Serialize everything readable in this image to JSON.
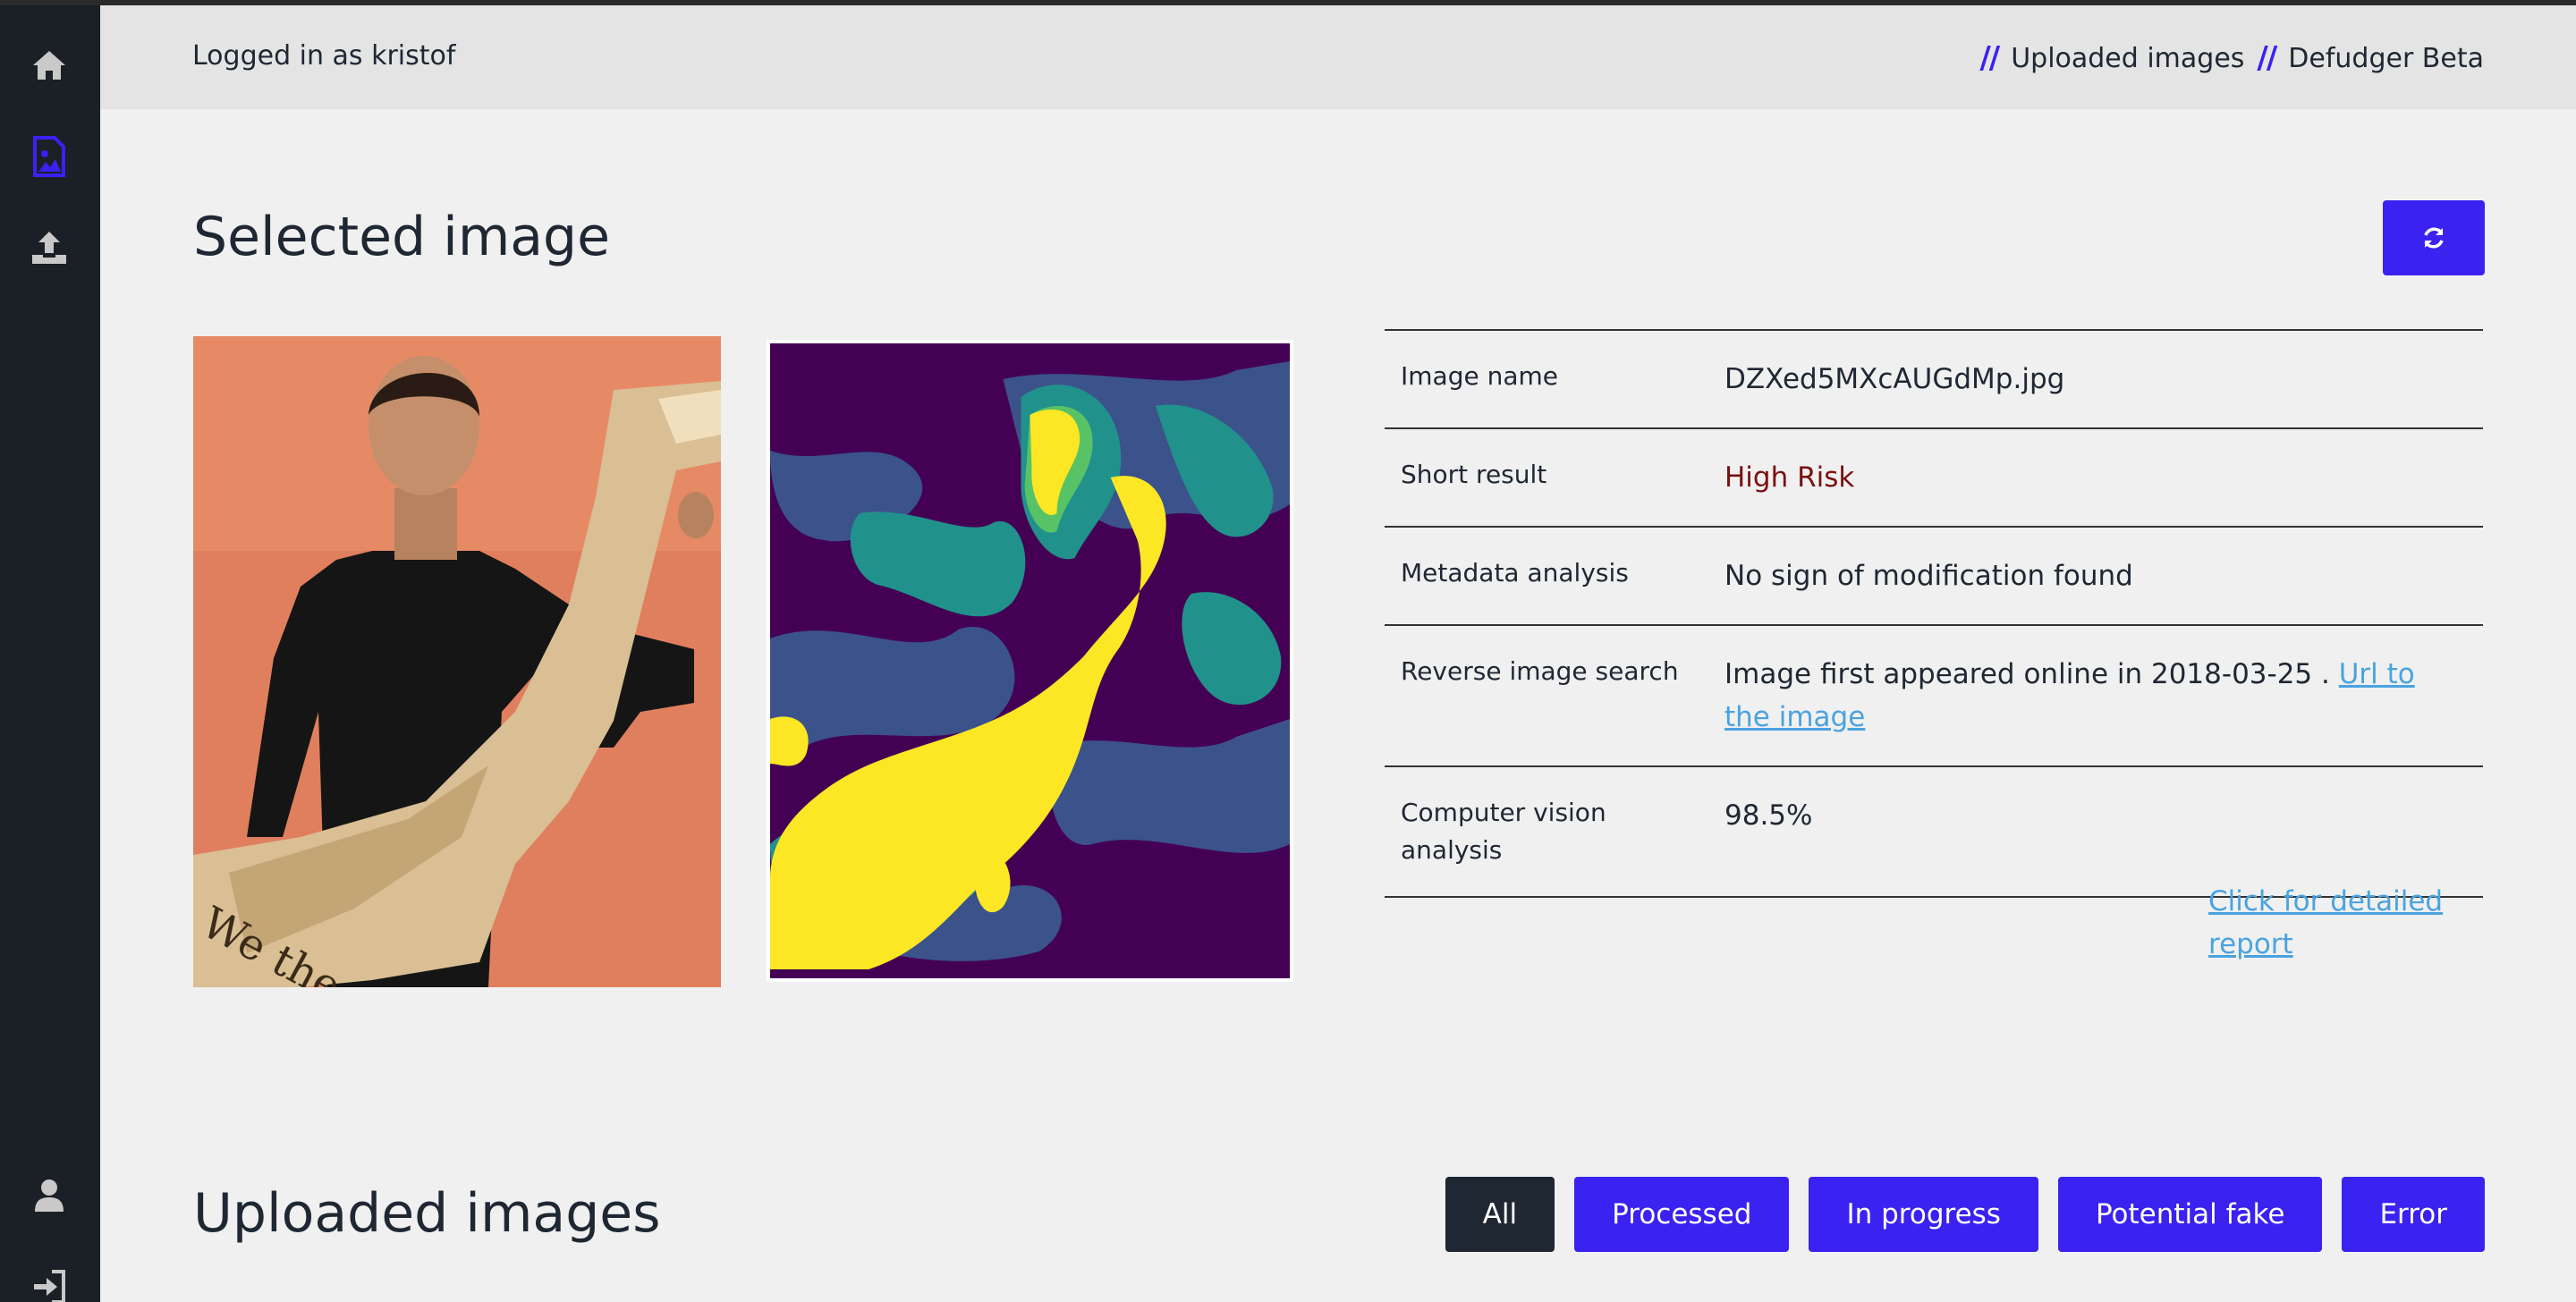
{
  "header": {
    "logged_in": "Logged in as kristof",
    "breadcrumbs": [
      {
        "sep": "//",
        "label": "Uploaded images"
      },
      {
        "sep": "//",
        "label": "Defudger Beta"
      }
    ]
  },
  "sidebar": {
    "items": [
      {
        "icon": "home-icon"
      },
      {
        "icon": "image-file-icon",
        "active": true
      },
      {
        "icon": "upload-icon"
      },
      {
        "icon": "user-icon"
      },
      {
        "icon": "sign-in-icon"
      }
    ]
  },
  "selected": {
    "title": "Selected image",
    "refresh_icon": "refresh-icon",
    "rows": [
      {
        "label": "Image name",
        "value": "DZXed5MXcAUGdMp.jpg"
      },
      {
        "label": "Short result",
        "value": "High Risk"
      },
      {
        "label": "Metadata analysis",
        "value": "No sign of modification found"
      },
      {
        "label": "Reverse image search",
        "value": "Image first appeared online in 2018-03-25 .",
        "link": "Url to the image"
      },
      {
        "label": "Computer vision analysis",
        "value": "98.5%"
      }
    ],
    "detail_link": "Click for detailed report"
  },
  "uploaded": {
    "title": "Uploaded images",
    "filters": [
      "All",
      "Processed",
      "In progress",
      "Potential fake",
      "Error"
    ],
    "active_filter": "All"
  },
  "colors": {
    "accent": "#3a22f0",
    "sidebar": "#1b1f26",
    "risk": "#7a1010",
    "link": "#4aa3df",
    "heatmap": [
      "#440154",
      "#3b528b",
      "#21918c",
      "#5ec962",
      "#fde725"
    ]
  }
}
